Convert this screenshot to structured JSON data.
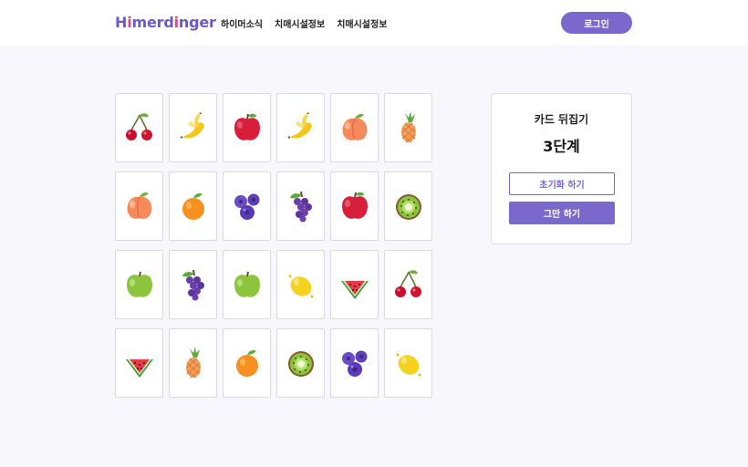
{
  "header": {
    "logo": {
      "pre": "H",
      "accent": "i",
      "mid": "merd",
      "accent2": "i",
      "post": "nger"
    },
    "nav": [
      "하이머소식",
      "치매시설정보",
      "치매시설정보"
    ],
    "login_label": "로그인"
  },
  "game": {
    "title": "카드 뒤집기",
    "level": "3단계",
    "reset_label": "초기화 하기",
    "quit_label": "그만 하기"
  },
  "cards": [
    "cherry",
    "banana",
    "apple",
    "banana",
    "peach",
    "pineapple",
    "peach",
    "orange",
    "blueberry",
    "grape",
    "apple",
    "kiwi",
    "green-apple",
    "grape",
    "green-apple",
    "lemon",
    "watermelon",
    "cherry",
    "watermelon",
    "pineapple",
    "orange",
    "kiwi",
    "blueberry",
    "lemon"
  ],
  "colors": {
    "accent": "#7b68cc",
    "logo": "#6b59c4",
    "logo_accent": "#d64a8c"
  }
}
